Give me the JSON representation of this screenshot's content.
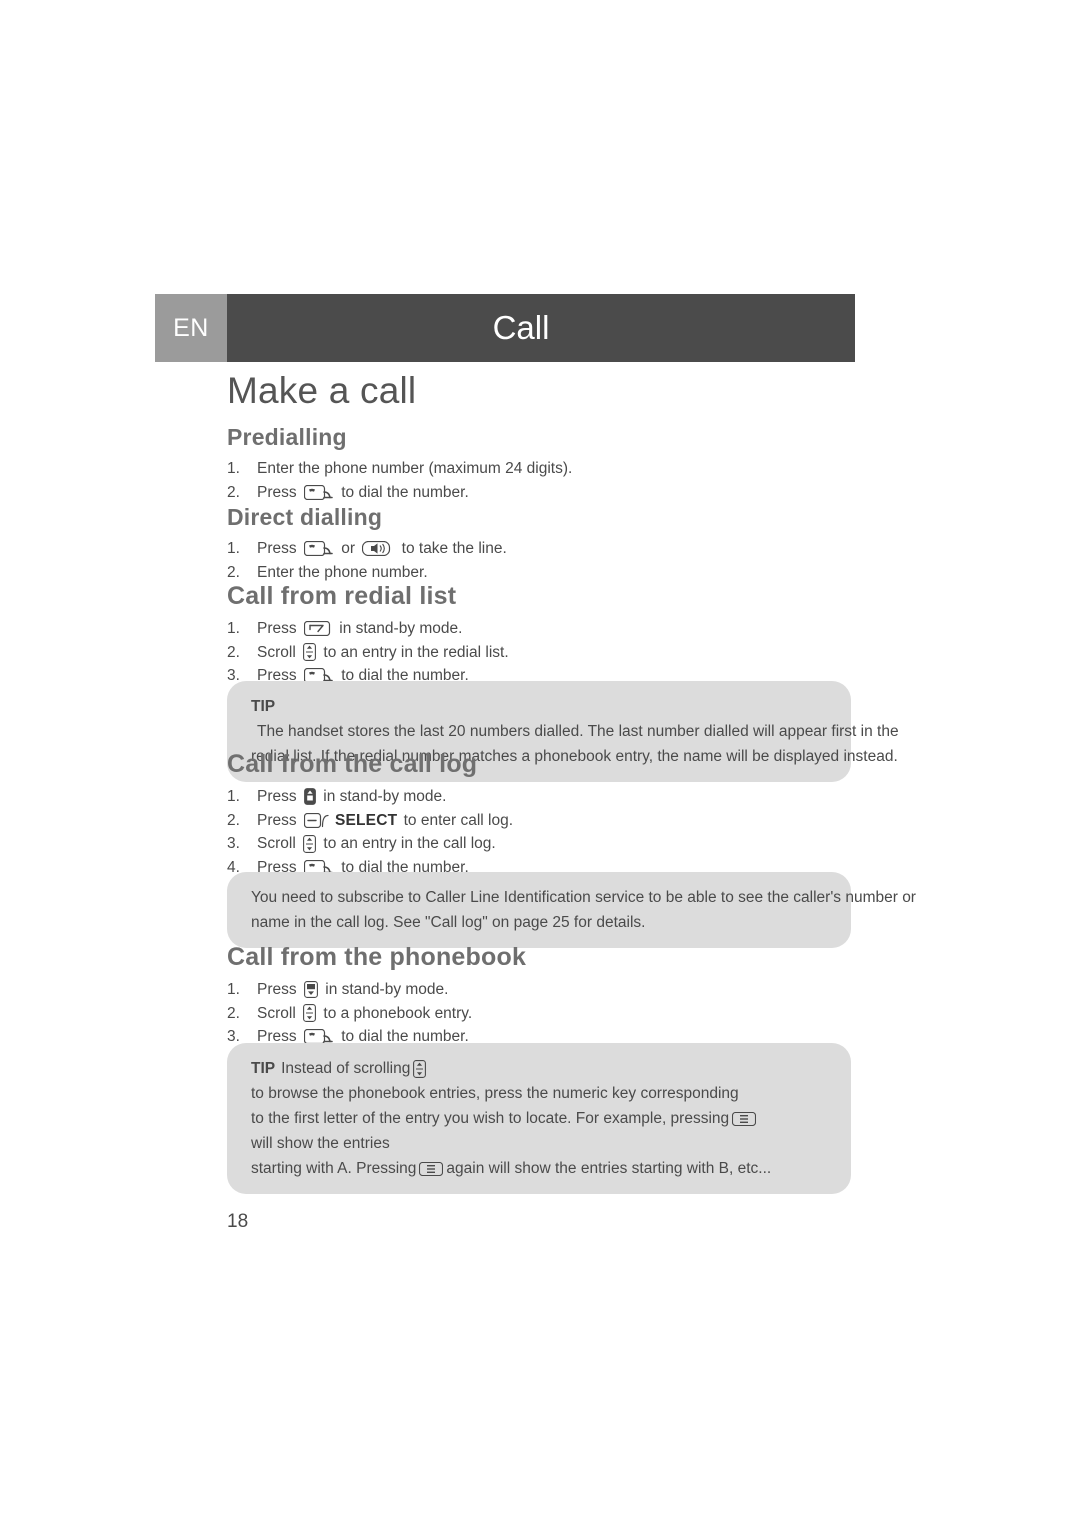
{
  "header": {
    "language_tab": "EN",
    "title": "Call"
  },
  "page_title": "Make a call",
  "sections": [
    {
      "id": "predialling",
      "heading": "Predialling",
      "steps": [
        {
          "num": "1.",
          "parts": [
            {
              "type": "text",
              "value": "Enter the phone number (maximum 24 digits)."
            }
          ]
        },
        {
          "num": "2.",
          "parts": [
            {
              "type": "text",
              "value": "Press "
            },
            {
              "type": "icon",
              "icon": "talk-key-icon"
            },
            {
              "type": "text",
              "value": " to dial the number."
            }
          ]
        }
      ]
    },
    {
      "id": "direct-dialling",
      "heading": "Direct dialling",
      "steps": [
        {
          "num": "1.",
          "parts": [
            {
              "type": "text",
              "value": "Press "
            },
            {
              "type": "icon",
              "icon": "talk-key-icon"
            },
            {
              "type": "text",
              "value": " or "
            },
            {
              "type": "icon",
              "icon": "speakerphone-key-icon"
            },
            {
              "type": "text",
              "value": " to take the line."
            }
          ]
        },
        {
          "num": "2.",
          "parts": [
            {
              "type": "text",
              "value": "Enter the phone number."
            }
          ]
        }
      ]
    },
    {
      "id": "call-from-redial-list",
      "heading": "Call from redial list",
      "steps": [
        {
          "num": "1.",
          "parts": [
            {
              "type": "text",
              "value": "Press "
            },
            {
              "type": "icon",
              "icon": "redial-key-icon"
            },
            {
              "type": "text",
              "value": " in stand-by mode."
            }
          ]
        },
        {
          "num": "2.",
          "parts": [
            {
              "type": "text",
              "value": "Scroll "
            },
            {
              "type": "icon",
              "icon": "up-down-key-icon"
            },
            {
              "type": "text",
              "value": " to an entry in the redial list."
            }
          ]
        },
        {
          "num": "3.",
          "parts": [
            {
              "type": "text",
              "value": "Press "
            },
            {
              "type": "icon",
              "icon": "talk-key-icon"
            },
            {
              "type": "text",
              "value": " to dial the number."
            }
          ]
        }
      ]
    },
    {
      "id": "call-from-the-call-log",
      "heading": "Call from the call log",
      "steps": [
        {
          "num": "1.",
          "parts": [
            {
              "type": "text",
              "value": "Press "
            },
            {
              "type": "icon",
              "icon": "menu-key-icon"
            },
            {
              "type": "text",
              "value": " in stand-by mode."
            }
          ]
        },
        {
          "num": "2.",
          "parts": [
            {
              "type": "text",
              "value": "Press "
            },
            {
              "type": "icon",
              "icon": "soft-key-icon"
            },
            {
              "type": "bold",
              "value": "SELECT"
            },
            {
              "type": "text",
              "value": " to enter call log."
            }
          ]
        },
        {
          "num": "3.",
          "parts": [
            {
              "type": "text",
              "value": "Scroll "
            },
            {
              "type": "icon",
              "icon": "up-down-key-icon"
            },
            {
              "type": "text",
              "value": " to an entry in the call log."
            }
          ]
        },
        {
          "num": "4.",
          "parts": [
            {
              "type": "text",
              "value": "Press "
            },
            {
              "type": "icon",
              "icon": "talk-key-icon"
            },
            {
              "type": "text",
              "value": " to dial the number."
            }
          ]
        }
      ]
    },
    {
      "id": "call-from-the-phonebook",
      "heading": "Call from the phonebook",
      "steps": [
        {
          "num": "1.",
          "parts": [
            {
              "type": "text",
              "value": "Press "
            },
            {
              "type": "icon",
              "icon": "phonebook-key-icon"
            },
            {
              "type": "text",
              "value": " in stand-by mode."
            }
          ]
        },
        {
          "num": "2.",
          "parts": [
            {
              "type": "text",
              "value": "Scroll "
            },
            {
              "type": "icon",
              "icon": "up-down-key-icon"
            },
            {
              "type": "text",
              "value": " to a phonebook entry."
            }
          ]
        },
        {
          "num": "3.",
          "parts": [
            {
              "type": "text",
              "value": "Press "
            },
            {
              "type": "icon",
              "icon": "talk-key-icon"
            },
            {
              "type": "text",
              "value": " to dial the number."
            }
          ]
        }
      ]
    }
  ],
  "boxes": {
    "redial_tip": {
      "label": "TIP",
      "lines": [
        "The handset stores the last 20 numbers dialled. The last number dialled will appear first in the",
        "redial list. If the redial number matches a phonebook entry, the name will be displayed instead."
      ]
    },
    "clip_note": {
      "lines": [
        "You need to subscribe to Caller Line Identification service to be able to see the caller's number or",
        "name in the call log. See \"Call log\" on page 25 for details."
      ]
    },
    "phonebook_tip": {
      "label": "TIP",
      "line1_a": "Instead of scrolling",
      "line1_b": "to browse the phonebook entries, press the numeric key corresponding",
      "line2_a": "to the first letter of the entry you wish to locate. For example, pressing",
      "line2_b": "will show the entries",
      "line3_a": "starting with A. Pressing",
      "line3_b": "again will show the entries starting with B, etc..."
    }
  },
  "page_number": "18",
  "colors": {
    "header_bar": "#4b4b4b",
    "lang_tab": "#9b9b9b",
    "box": "#dcdcdc",
    "heading": "#6f6f6f",
    "body_text": "#4a4a4a"
  }
}
